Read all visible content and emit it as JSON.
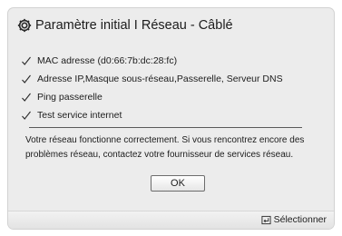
{
  "dialog": {
    "title": "Paramètre initial I Réseau - Câblé",
    "title_icon": "gear-icon",
    "checks": [
      {
        "label": "MAC adresse (d0:66:7b:dc:28:fc)",
        "icon": "check-icon"
      },
      {
        "label": "Adresse IP,Masque sous-réseau,Passerelle, Serveur DNS",
        "icon": "check-icon"
      },
      {
        "label": "Ping passerelle",
        "icon": "check-icon"
      },
      {
        "label": "Test service internet",
        "icon": "check-icon"
      }
    ],
    "message": "Votre réseau fonctionne correctement. Si vous rencontrez encore des problèmes réseau, contactez votre fournisseur de services réseau.",
    "ok_label": "OK"
  },
  "footer": {
    "select_label": "Sélectionner",
    "select_icon": "enter-icon"
  }
}
